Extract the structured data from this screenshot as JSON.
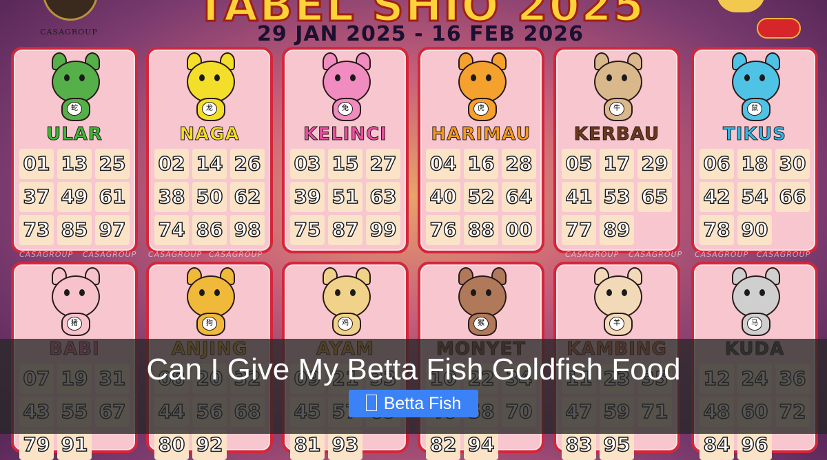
{
  "poster": {
    "title": "TABEL SHIO 2025",
    "date_range": "29 JAN 2025 - 16 FEB 2026",
    "logo_text": "CASAGROUP",
    "watermark": "CASAGROUP"
  },
  "shio": [
    {
      "name": "ULAR",
      "glyph": "蛇",
      "name_color": "#3db83a",
      "skin": "#55b04a",
      "numbers": [
        "01",
        "13",
        "25",
        "37",
        "49",
        "61",
        "73",
        "85",
        "97"
      ]
    },
    {
      "name": "NAGA",
      "glyph": "龙",
      "name_color": "#f2e21a",
      "skin": "#f3de2a",
      "numbers": [
        "02",
        "14",
        "26",
        "38",
        "50",
        "62",
        "74",
        "86",
        "98"
      ]
    },
    {
      "name": "KELINCI",
      "glyph": "兔",
      "name_color": "#ea4fa0",
      "skin": "#f08cbf",
      "numbers": [
        "03",
        "15",
        "27",
        "39",
        "51",
        "63",
        "75",
        "87",
        "99"
      ]
    },
    {
      "name": "HARIMAU",
      "glyph": "虎",
      "name_color": "#f39a1e",
      "skin": "#f5a12e",
      "numbers": [
        "04",
        "16",
        "28",
        "40",
        "52",
        "64",
        "76",
        "88",
        "00"
      ]
    },
    {
      "name": "KERBAU",
      "glyph": "牛",
      "name_color": "#6b3a1e",
      "skin": "#d9b88c",
      "numbers": [
        "05",
        "17",
        "29",
        "41",
        "53",
        "65",
        "77",
        "89",
        ""
      ]
    },
    {
      "name": "TIKUS",
      "glyph": "鼠",
      "name_color": "#2cb9e8",
      "skin": "#4fc3e6",
      "numbers": [
        "06",
        "18",
        "30",
        "42",
        "54",
        "66",
        "78",
        "90",
        ""
      ]
    },
    {
      "name": "BABI",
      "glyph": "猪",
      "name_color": "#f06aa0",
      "skin": "#f7c2cc",
      "numbers": [
        "07",
        "19",
        "31",
        "43",
        "55",
        "67",
        "79",
        "91",
        ""
      ]
    },
    {
      "name": "ANJING",
      "glyph": "狗",
      "name_color": "#e6a81e",
      "skin": "#f1b93a",
      "numbers": [
        "08",
        "20",
        "32",
        "44",
        "56",
        "68",
        "80",
        "92",
        ""
      ]
    },
    {
      "name": "AYAM",
      "glyph": "鸡",
      "name_color": "#e89a1e",
      "skin": "#f1d28a",
      "numbers": [
        "09",
        "21",
        "33",
        "45",
        "57",
        "69",
        "81",
        "93",
        ""
      ]
    },
    {
      "name": "MONYET",
      "glyph": "猴",
      "name_color": "#8a4a2a",
      "skin": "#b07a5a",
      "numbers": [
        "10",
        "22",
        "34",
        "46",
        "58",
        "70",
        "82",
        "94",
        ""
      ]
    },
    {
      "name": "KAMBING",
      "glyph": "羊",
      "name_color": "#d86a3a",
      "skin": "#f2d9b8",
      "numbers": [
        "11",
        "23",
        "35",
        "47",
        "59",
        "71",
        "83",
        "95",
        ""
      ]
    },
    {
      "name": "KUDA",
      "glyph": "马",
      "name_color": "#4a4a4a",
      "skin": "#cfcfcf",
      "numbers": [
        "12",
        "24",
        "36",
        "48",
        "60",
        "72",
        "84",
        "96",
        ""
      ]
    }
  ],
  "article": {
    "headline": "Can I Give My Betta Fish Goldfish Food",
    "category_label": "Betta Fish",
    "category_icon": "document-icon",
    "category_color": "#3b82f6"
  }
}
